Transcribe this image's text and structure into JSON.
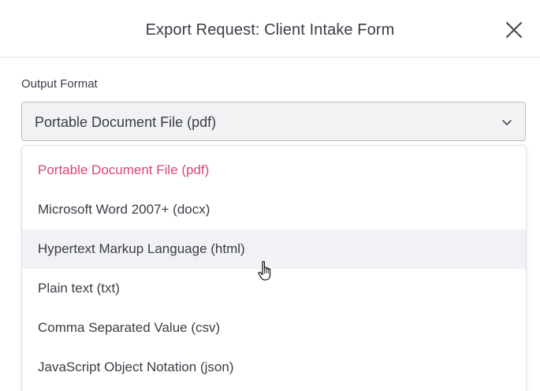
{
  "modal": {
    "title": "Export Request: Client Intake Form",
    "close_icon": "close-icon"
  },
  "form": {
    "field_label": "Output Format",
    "selected_value": "Portable Document File (pdf)",
    "chevron_icon": "chevron-down-icon"
  },
  "dropdown": {
    "options": [
      {
        "label": "Portable Document File (pdf)",
        "state": "selected"
      },
      {
        "label": "Microsoft Word 2007+ (docx)",
        "state": "normal"
      },
      {
        "label": "Hypertext Markup Language (html)",
        "state": "hovered"
      },
      {
        "label": "Plain text (txt)",
        "state": "normal"
      },
      {
        "label": "Comma Separated Value (csv)",
        "state": "normal"
      },
      {
        "label": "JavaScript Object Notation (json)",
        "state": "normal"
      }
    ]
  },
  "colors": {
    "selected_option": "#d9447c",
    "text": "#3a3d46",
    "hover_bg": "#f1f2f5",
    "select_bg": "#f1f2f4"
  },
  "cursor": {
    "icon": "hand-pointer-icon"
  }
}
